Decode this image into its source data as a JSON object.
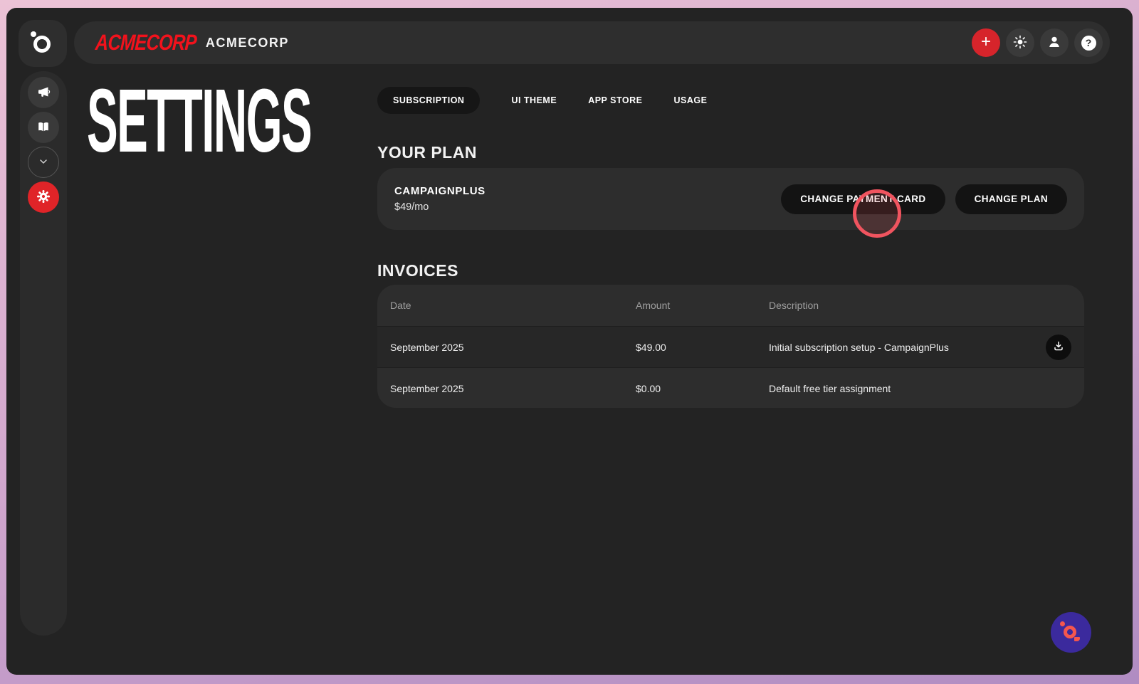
{
  "colors": {
    "accent_red": "#d6242b",
    "brand_red": "#f2121c",
    "active_gear_red": "#e02428",
    "click_ring": "#f0545f",
    "assistant_purple": "#3b2a9d",
    "assistant_coral": "#f4564e",
    "frame_border_top": "#ecc3d6",
    "frame_border_bottom": "#b08cc2"
  },
  "topbar": {
    "brand_logo": "ACMECORP",
    "brand_name": "ACMECORP",
    "actions": [
      {
        "name": "add",
        "icon": "plus-icon"
      },
      {
        "name": "theme-toggle",
        "icon": "sun-icon"
      },
      {
        "name": "account",
        "icon": "person-icon"
      },
      {
        "name": "help",
        "icon": "question-icon",
        "glyph": "?"
      }
    ]
  },
  "sidebar": {
    "items": [
      {
        "name": "campaigns",
        "icon": "megaphone-icon",
        "active": false
      },
      {
        "name": "library",
        "icon": "book-icon",
        "active": false
      },
      {
        "name": "expand",
        "icon": "chevron-down-icon",
        "active": false
      },
      {
        "name": "settings",
        "icon": "gear-icon",
        "active": true
      }
    ]
  },
  "page": {
    "title": "SETTINGS"
  },
  "tabs": [
    {
      "label": "SUBSCRIPTION",
      "active": true
    },
    {
      "label": "UI THEME",
      "active": false
    },
    {
      "label": "APP STORE",
      "active": false
    },
    {
      "label": "USAGE",
      "active": false
    }
  ],
  "plan": {
    "heading": "YOUR PLAN",
    "name": "CAMPAIGNPLUS",
    "price": "$49/mo",
    "change_card_label": "CHANGE PAYMENT CARD",
    "change_plan_label": "CHANGE PLAN"
  },
  "invoices": {
    "heading": "INVOICES",
    "columns": [
      "Date",
      "Amount",
      "Description"
    ],
    "rows": [
      {
        "date": "September 2025",
        "amount": "$49.00",
        "description": "Initial subscription setup - CampaignPlus",
        "download": true
      },
      {
        "date": "September 2025",
        "amount": "$0.00",
        "description": "Default free tier assignment",
        "download": false
      }
    ]
  }
}
